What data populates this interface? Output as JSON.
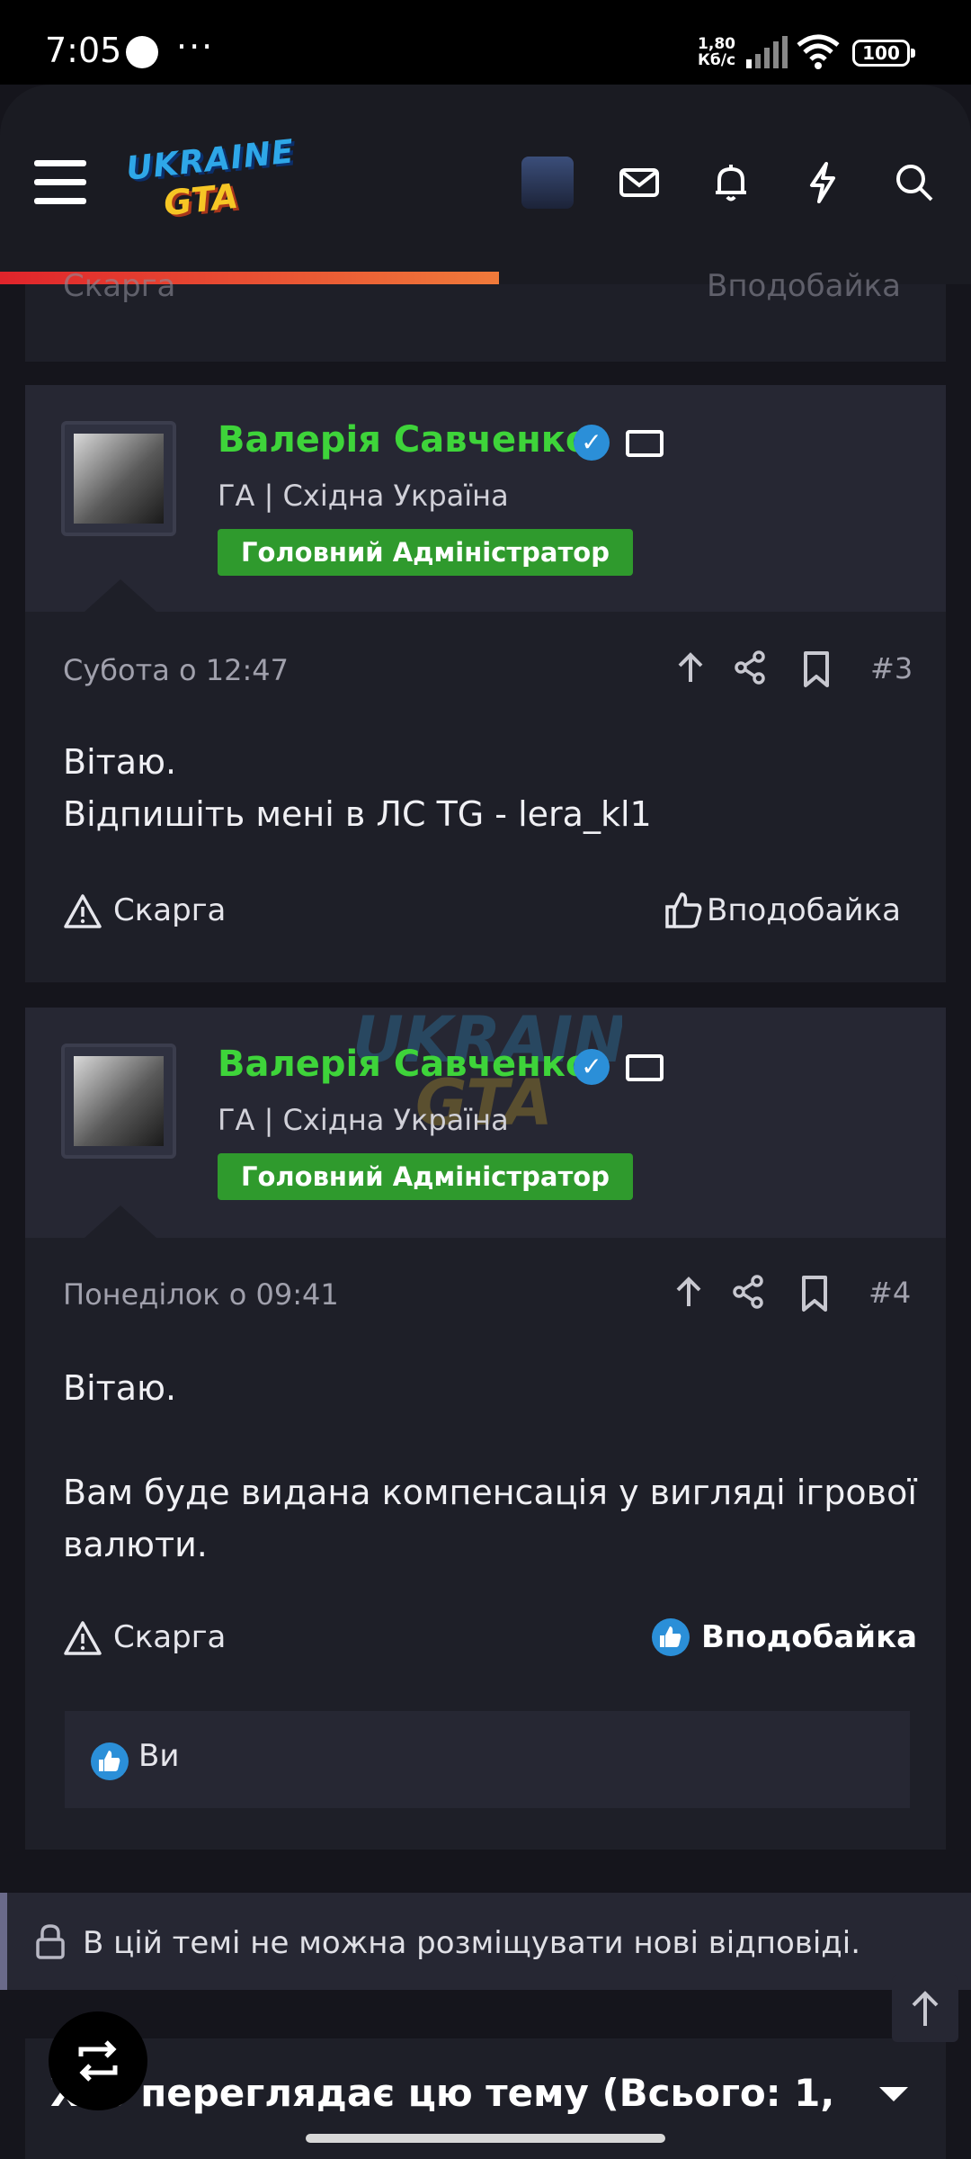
{
  "status_bar": {
    "time": "7:05",
    "dots": "···",
    "speed": "1,80",
    "speed_unit": "Кб/с",
    "battery": "100"
  },
  "header": {
    "logo_top": "UKRAINE",
    "logo_bottom": "GTA"
  },
  "prev_post_footer": {
    "report": "Скарга",
    "like": "Вподобайка"
  },
  "posts": [
    {
      "author": "Валерія Савченко",
      "subtitle": "ГА | Східна Україна",
      "badge": "Головний Адміністратор",
      "date": "Субота о 12:47",
      "number": "#3",
      "body_line1": "Вітаю.",
      "body_line2": "Відпишіть мені в ЛС TG - lera_kl1",
      "report": "Скарга",
      "like": "Вподобайка"
    },
    {
      "author": "Валерія Савченко",
      "subtitle": "ГА | Східна Україна",
      "badge": "Головний Адміністратор",
      "date": "Понеділок о 09:41",
      "number": "#4",
      "body_line1": "Вітаю.",
      "body_line2": "Вам буде видана компенсація у вигляді ігрової",
      "body_line3": "валюти.",
      "report": "Скарга",
      "like": "Вподобайка",
      "liked_by": "Ви"
    }
  ],
  "locked_notice": "В цій темі не можна розміщувати нові відповіді.",
  "viewers_title": "Хто переглядає цю тему (Всього: 1,",
  "colors": {
    "accent_green": "#3ed43a",
    "badge_green": "#2f9a2d",
    "verify_blue": "#2b8fd8",
    "progress_start": "#e0242b",
    "progress_end": "#f07a3a"
  }
}
